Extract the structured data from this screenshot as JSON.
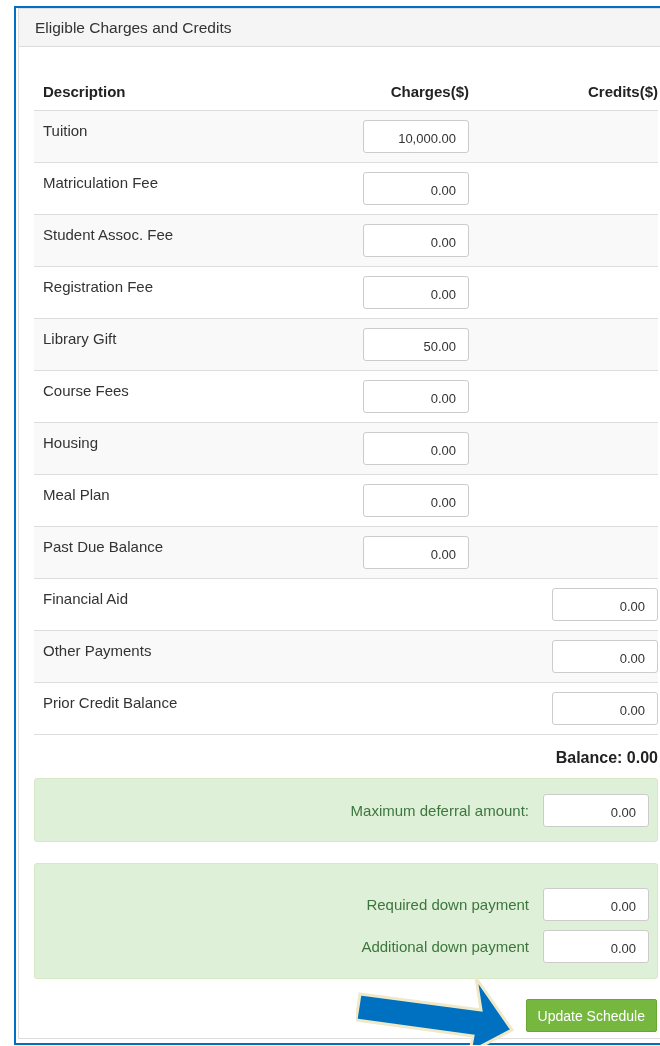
{
  "panel": {
    "title": "Eligible Charges and Credits"
  },
  "table": {
    "columns": [
      "Description",
      "Charges($)",
      "Credits($)"
    ],
    "rows": [
      {
        "label": "Tuition",
        "kind": "charge",
        "value": "10,000.00"
      },
      {
        "label": "Matriculation Fee",
        "kind": "charge",
        "value": "0.00"
      },
      {
        "label": "Student Assoc. Fee",
        "kind": "charge",
        "value": "0.00"
      },
      {
        "label": "Registration Fee",
        "kind": "charge",
        "value": "0.00"
      },
      {
        "label": "Library Gift",
        "kind": "charge",
        "value": "50.00"
      },
      {
        "label": "Course Fees",
        "kind": "charge",
        "value": "0.00"
      },
      {
        "label": "Housing",
        "kind": "charge",
        "value": "0.00"
      },
      {
        "label": "Meal Plan",
        "kind": "charge",
        "value": "0.00"
      },
      {
        "label": "Past Due Balance",
        "kind": "charge",
        "value": "0.00"
      },
      {
        "label": "Financial Aid",
        "kind": "credit",
        "value": "0.00"
      },
      {
        "label": "Other Payments",
        "kind": "credit",
        "value": "0.00"
      },
      {
        "label": "Prior Credit Balance",
        "kind": "credit",
        "value": "0.00"
      }
    ]
  },
  "balance": "Balance: 0.00",
  "deferral": {
    "label": "Maximum deferral amount:",
    "value": "0.00"
  },
  "down_payments": [
    {
      "label": "Required down payment",
      "value": "0.00"
    },
    {
      "label": "Additional down payment",
      "value": "0.00"
    }
  ],
  "button": "Update Schedule"
}
